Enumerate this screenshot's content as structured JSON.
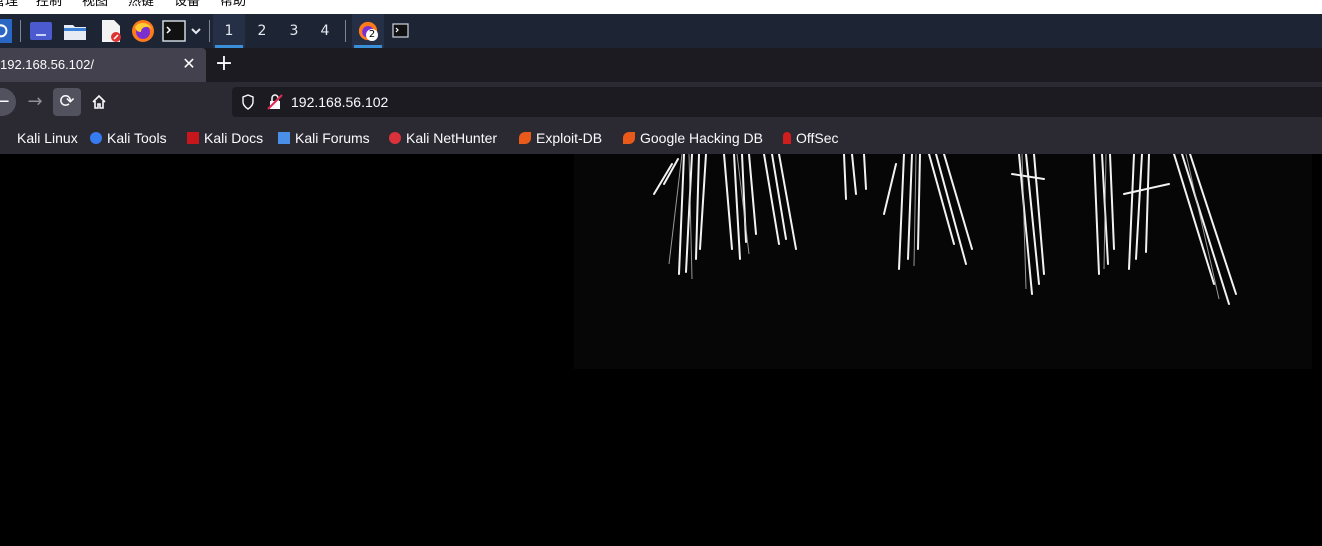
{
  "vm_menu": [
    "管理",
    "控制",
    "视图",
    "热键",
    "设备",
    "帮助"
  ],
  "panel": {
    "workspaces": [
      "1",
      "2",
      "3",
      "4"
    ],
    "active_workspace": "1",
    "notification_count": "2"
  },
  "browser": {
    "tab_title": "192.168.56.102/",
    "url": "192.168.56.102",
    "bookmarks": [
      {
        "label": "Kali Linux",
        "icon": "kali-dragon-icon"
      },
      {
        "label": "Kali Tools",
        "icon": "kali-tools-icon"
      },
      {
        "label": "Kali Docs",
        "icon": "kali-docs-icon"
      },
      {
        "label": "Kali Forums",
        "icon": "kali-forums-icon"
      },
      {
        "label": "Kali NetHunter",
        "icon": "nethunter-icon"
      },
      {
        "label": "Exploit-DB",
        "icon": "exploit-db-icon"
      },
      {
        "label": "Google Hacking DB",
        "icon": "ghdb-icon"
      },
      {
        "label": "OffSec",
        "icon": "offsec-icon"
      }
    ]
  },
  "colors": {
    "panel_bg": "#1d2433",
    "workspace_accent": "#3a8fdb",
    "browser_chrome": "#2b2a33",
    "page_bg": "#000000"
  }
}
